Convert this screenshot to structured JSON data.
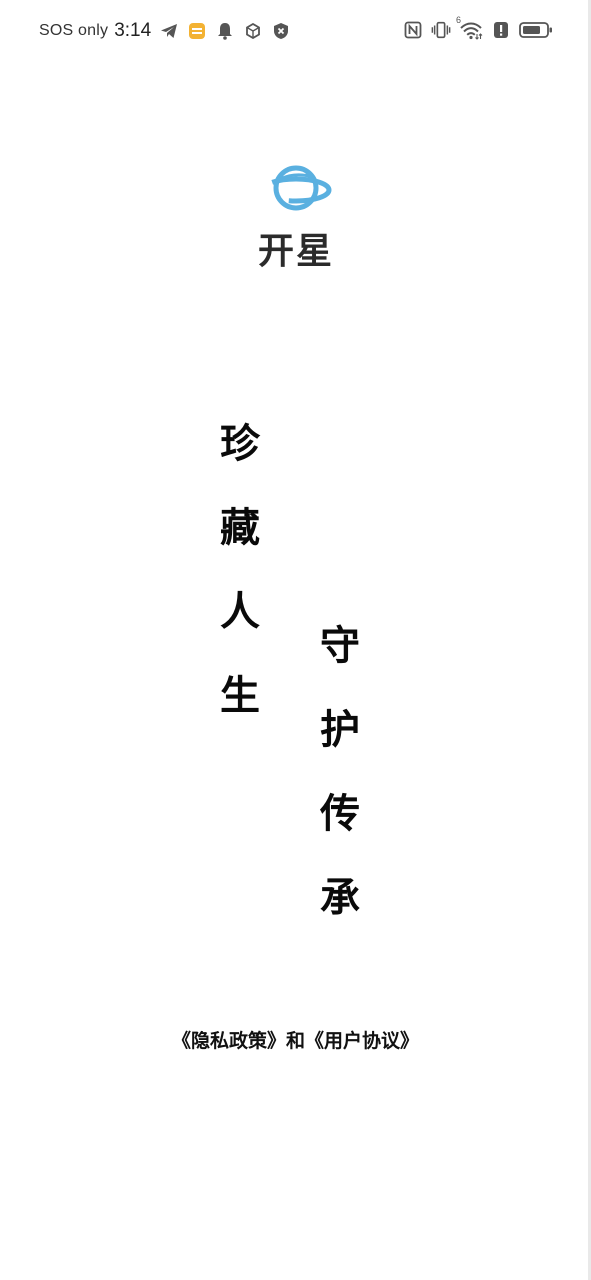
{
  "status_bar": {
    "carrier": "SOS only",
    "time": "3:14",
    "left_icons": [
      "telegram-icon",
      "notes-icon",
      "bell-icon",
      "vpn-icon",
      "shield-x-icon"
    ],
    "right_icons": [
      "nfc-icon",
      "vibrate-icon",
      "wifi-6-icon",
      "alert-icon",
      "battery-icon"
    ],
    "wifi_badge": "6"
  },
  "logo": {
    "title": "开星",
    "planet_color": "#5ab0e0"
  },
  "slogan": {
    "left_column": [
      "珍",
      "藏",
      "人",
      "生"
    ],
    "right_column": [
      "守",
      "护",
      "传",
      "承"
    ]
  },
  "agreement": {
    "privacy_label": "《隐私政策》",
    "and_label": "和",
    "user_agreement_label": "《用户协议》"
  }
}
